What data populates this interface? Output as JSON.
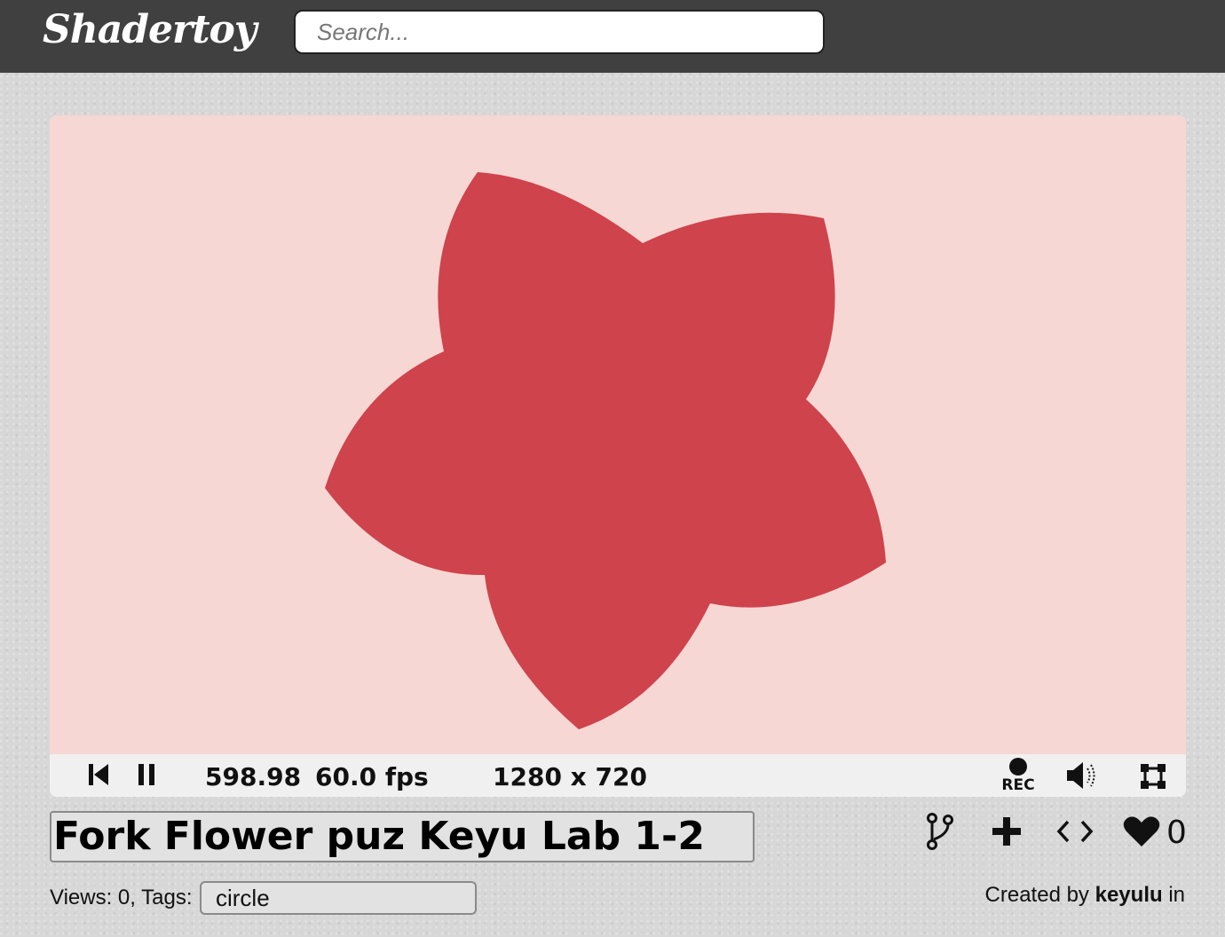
{
  "header": {
    "logo": "Shadertoy",
    "search_placeholder": "Search..."
  },
  "player": {
    "time": "598.98",
    "fps": "60.0 fps",
    "resolution": "1280 x 720",
    "rec_label": "REC",
    "background_color": "#f7d7d3",
    "flower_color": "#cf434c"
  },
  "shader": {
    "title": "Fork Flower puz Keyu Lab 1-2",
    "like_count": "0",
    "views_label": "Views: 0, Tags:",
    "tag": "circle",
    "created_by_prefix": "Created by",
    "author": "keyulu",
    "created_by_suffix": "in"
  }
}
